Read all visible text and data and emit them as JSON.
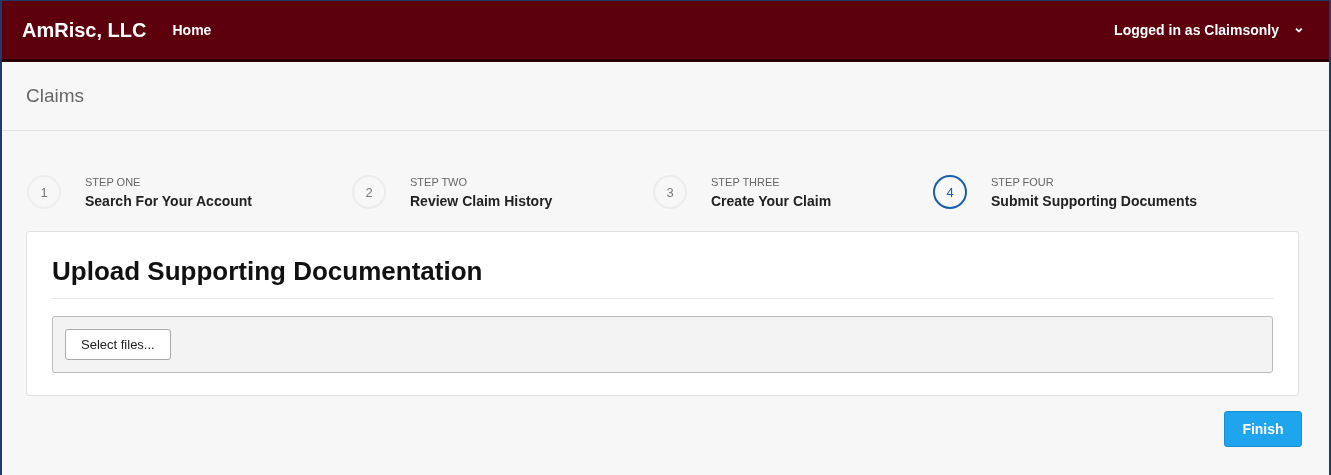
{
  "header": {
    "brand": "AmRisc, LLC",
    "nav": [
      {
        "label": "Home"
      }
    ],
    "user_menu": {
      "label": "Logged in as Claimsonly",
      "caret": "⌄"
    }
  },
  "page_title": "Claims",
  "steps": [
    {
      "number": "1",
      "kicker": "STEP ONE",
      "title": "Search For Your Account",
      "selected": false
    },
    {
      "number": "2",
      "kicker": "STEP TWO",
      "title": "Review Claim History",
      "selected": false
    },
    {
      "number": "3",
      "kicker": "STEP THREE",
      "title": "Create Your Claim",
      "selected": false
    },
    {
      "number": "4",
      "kicker": "STEP FOUR",
      "title": "Submit Supporting Documents",
      "selected": true
    }
  ],
  "upload": {
    "heading": "Upload Supporting Documentation",
    "select_button": "Select files..."
  },
  "finish_button": "Finish"
}
